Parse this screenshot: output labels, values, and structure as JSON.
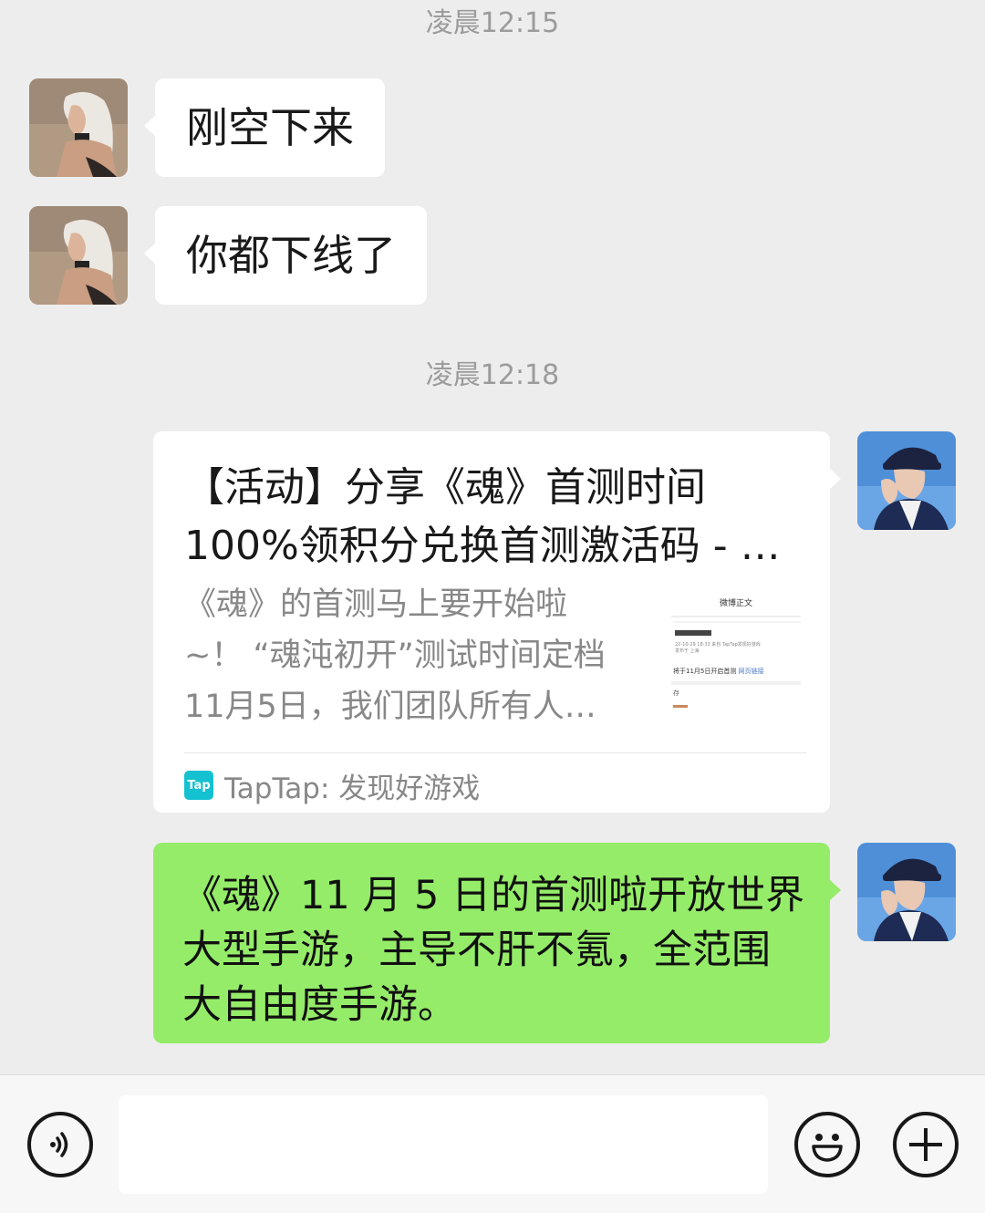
{
  "timestamps": [
    "凌晨12:15",
    "凌晨12:18"
  ],
  "messages": {
    "m1": "刚空下来",
    "m2": "你都下线了",
    "card": {
      "title_line1": "【活动】分享《魂》首测时间",
      "title_line2": "100%领积分兑换首测激活码 - …",
      "desc_line1": "《魂》的首测马上要开始啦",
      "desc_line2": "~！ “魂沌初开”测试时间定档",
      "desc_line3": "11月5日，我们团队所有人…",
      "thumb_header": "微博正文",
      "thumb_meta": "22-10-29 18:33  来自 TapTap发现好游戏",
      "thumb_meta2": "发布于 上海",
      "thumb_line": "将于11月5日开启首测",
      "thumb_link": "网页链接",
      "thumb_char": "存",
      "source_logo": "Tap",
      "source": "TapTap: 发现好游戏"
    },
    "m4_line1": "《魂》11 月 5 日的首测啦开放世界",
    "m4_line2": "大型手游，主导不肝不氪，全范围",
    "m4_line3": "大自由度手游。"
  },
  "input": {
    "placeholder": ""
  },
  "icons": {
    "voice": "voice-icon",
    "emoji": "emoji-icon",
    "plus": "plus-icon"
  },
  "colors": {
    "background": "#ededed",
    "bubble_received": "#ffffff",
    "bubble_sent": "#95ec69",
    "taptap": "#14c1d0"
  }
}
